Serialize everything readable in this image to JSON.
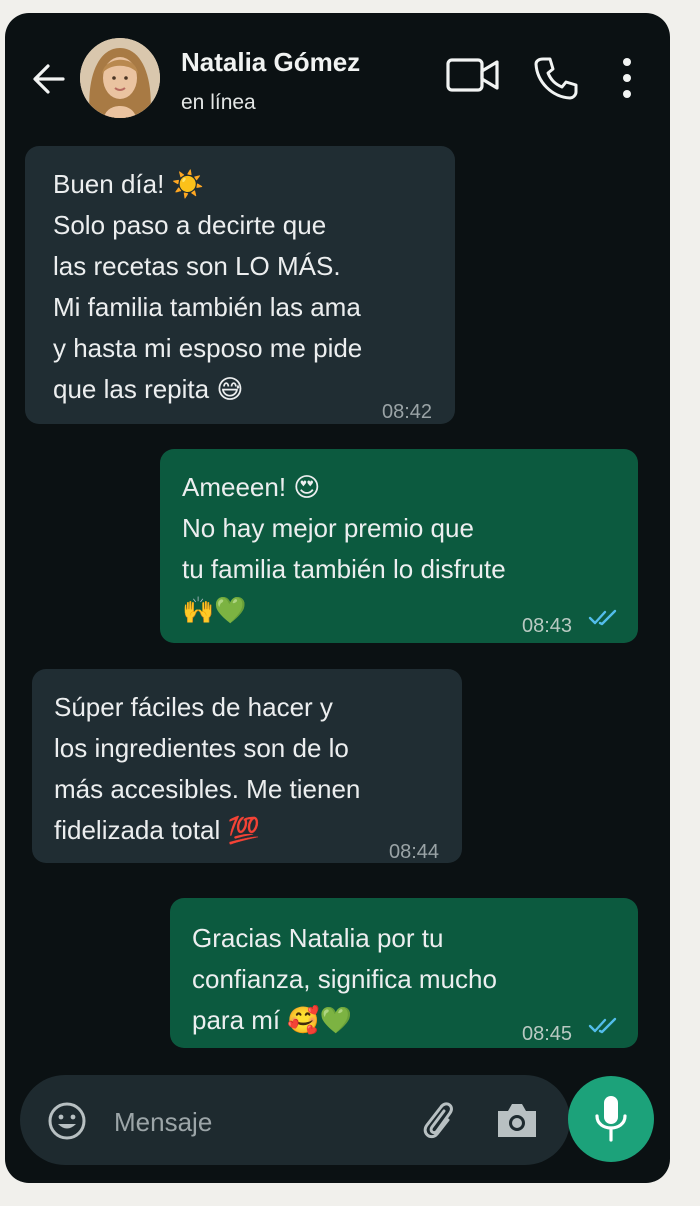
{
  "header": {
    "contact_name": "Natalia Gómez",
    "status": "en línea"
  },
  "messages": [
    {
      "direction": "incoming",
      "lines": [
        "Buen día! ☀️",
        "Solo paso a decirte que",
        "las recetas son LO MÁS.",
        "Mi familia también las ama",
        "y hasta mi esposo me pide",
        "que las repita 😅"
      ],
      "time": "08:42"
    },
    {
      "direction": "outgoing",
      "lines": [
        "Ameeen! 😍",
        "No hay mejor premio que",
        "tu familia también lo disfrute",
        "🙌💚"
      ],
      "time": "08:43",
      "read": true
    },
    {
      "direction": "incoming",
      "lines": [
        "Súper fáciles de hacer y",
        "los ingredientes son de lo",
        "más accesibles. Me tienen",
        "fidelizada total 💯"
      ],
      "time": "08:44"
    },
    {
      "direction": "outgoing",
      "lines": [
        "Gracias Natalia por tu",
        "confianza, significa mucho",
        "para mí 🥰💚"
      ],
      "time": "08:45",
      "read": true
    }
  ],
  "composer": {
    "placeholder": "Mensaje"
  },
  "colors": {
    "background": "#0b1113",
    "incoming_bubble": "#202d33",
    "outgoing_bubble": "#0c5a3f",
    "accent": "#1ca27a",
    "read_ticks": "#53bdeb"
  },
  "icons": [
    "back-arrow-icon",
    "video-call-icon",
    "phone-icon",
    "more-menu-icon",
    "emoji-icon",
    "attach-icon",
    "camera-icon",
    "mic-icon"
  ]
}
